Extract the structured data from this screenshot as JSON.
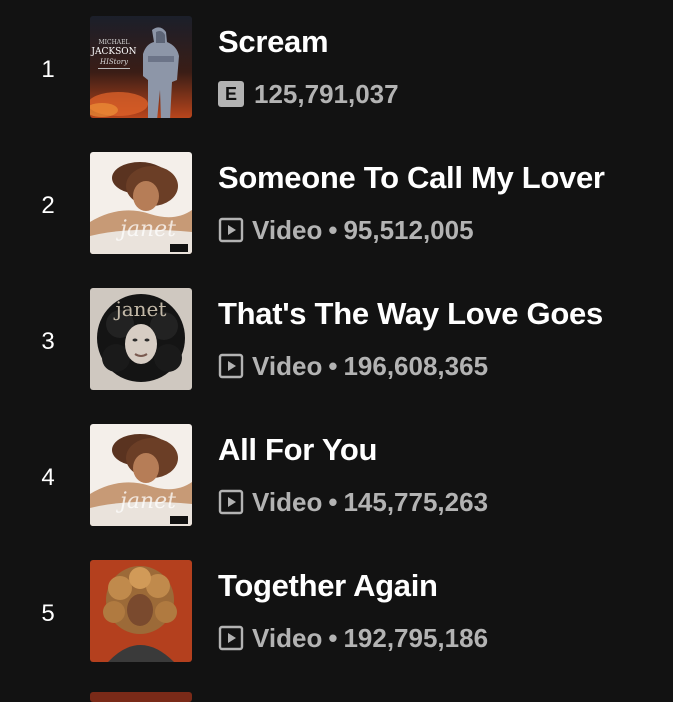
{
  "tracks": [
    {
      "rank": "1",
      "title": "Scream",
      "explicit": "E",
      "plays": "125,791,037",
      "cover": "history-album-cover"
    },
    {
      "rank": "2",
      "title": "Someone To Call My Lover",
      "type": "Video",
      "separator": "•",
      "plays": "95,512,005",
      "cover": "all-for-you-album-cover"
    },
    {
      "rank": "3",
      "title": "That's The Way Love Goes",
      "type": "Video",
      "separator": "•",
      "plays": "196,608,365",
      "cover": "janet-album-cover"
    },
    {
      "rank": "4",
      "title": "All For You",
      "type": "Video",
      "separator": "•",
      "plays": "145,775,263",
      "cover": "all-for-you-album-cover"
    },
    {
      "rank": "5",
      "title": "Together Again",
      "type": "Video",
      "separator": "•",
      "plays": "192,795,186",
      "cover": "velvet-rope-album-cover"
    }
  ],
  "cover_art": {
    "history_text": [
      "MICHAEL",
      "JACKSON",
      "HIStory"
    ],
    "janet_script": "janet",
    "parental_advisory": "PARENTAL ADVISORY"
  },
  "colors": {
    "background": "#121212",
    "primary_text": "#ffffff",
    "secondary_text": "#b3b3b3"
  }
}
